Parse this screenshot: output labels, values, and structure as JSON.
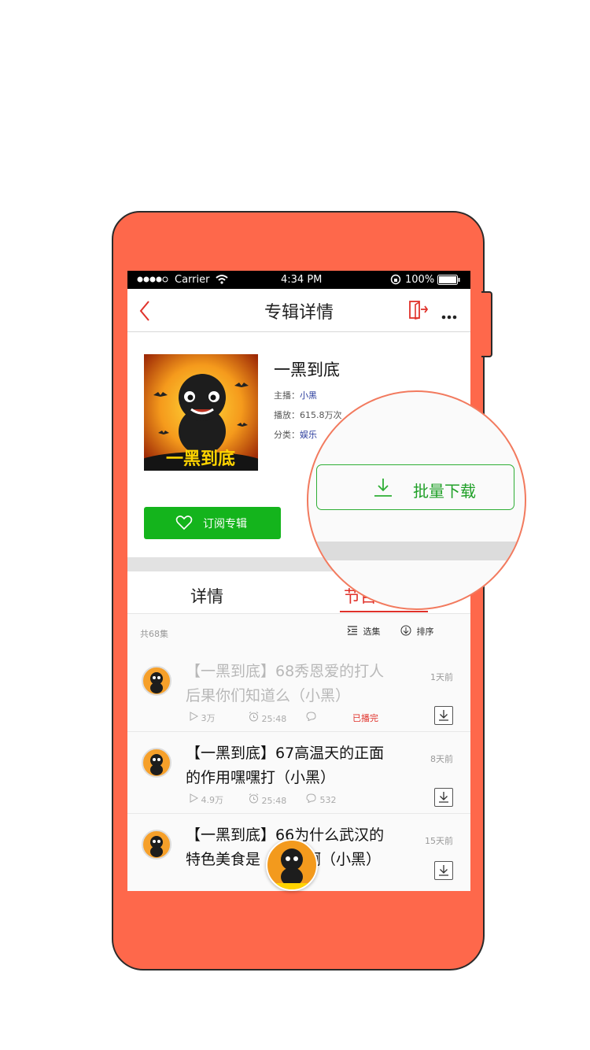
{
  "status_bar": {
    "carrier": "Carrier",
    "time": "4:34 PM",
    "battery": "100%"
  },
  "nav": {
    "title": "专辑详情",
    "back_icon": "chevron-left",
    "share_icon": "exit-share",
    "more_icon": "more-horizontal"
  },
  "album": {
    "title": "一黑到底",
    "cover_text": "一黑到底",
    "host_label": "主播：",
    "host": "小黑",
    "plays_label": "播放：",
    "plays": "615.8万次",
    "category_label": "分类：",
    "category": "娱乐"
  },
  "buttons": {
    "subscribe": "订阅专辑",
    "batch_download": "批量下载"
  },
  "tabs": {
    "details": "详情",
    "episodes_partial": "节目"
  },
  "toolbar": {
    "count": "共68集",
    "select": "选集",
    "sort": "排序"
  },
  "episodes": [
    {
      "title_line1": "【一黑到底】68秀恩爱的打人",
      "title_line2": "后果你们知道么（小黑）",
      "time_ago": "1天前",
      "plays": "3万",
      "duration": "25:48",
      "comments": "",
      "status": "已播完"
    },
    {
      "title_line1": "【一黑到底】67高温天的正面",
      "title_line2": "的作用嘿嘿打（小黑）",
      "time_ago": "8天前",
      "plays": "4.9万",
      "duration": "25:48",
      "comments": "532",
      "status": ""
    },
    {
      "title_line1": "【一黑到底】66为什么武汉的",
      "title_line2": "特色美食是",
      "title_line2b": "啊（小黑）",
      "time_ago": "15天前"
    }
  ],
  "colors": {
    "phone_body": "#fe684b",
    "accent_red": "#e0312a",
    "green": "#14b41c",
    "link_blue": "#2c3e9e"
  }
}
